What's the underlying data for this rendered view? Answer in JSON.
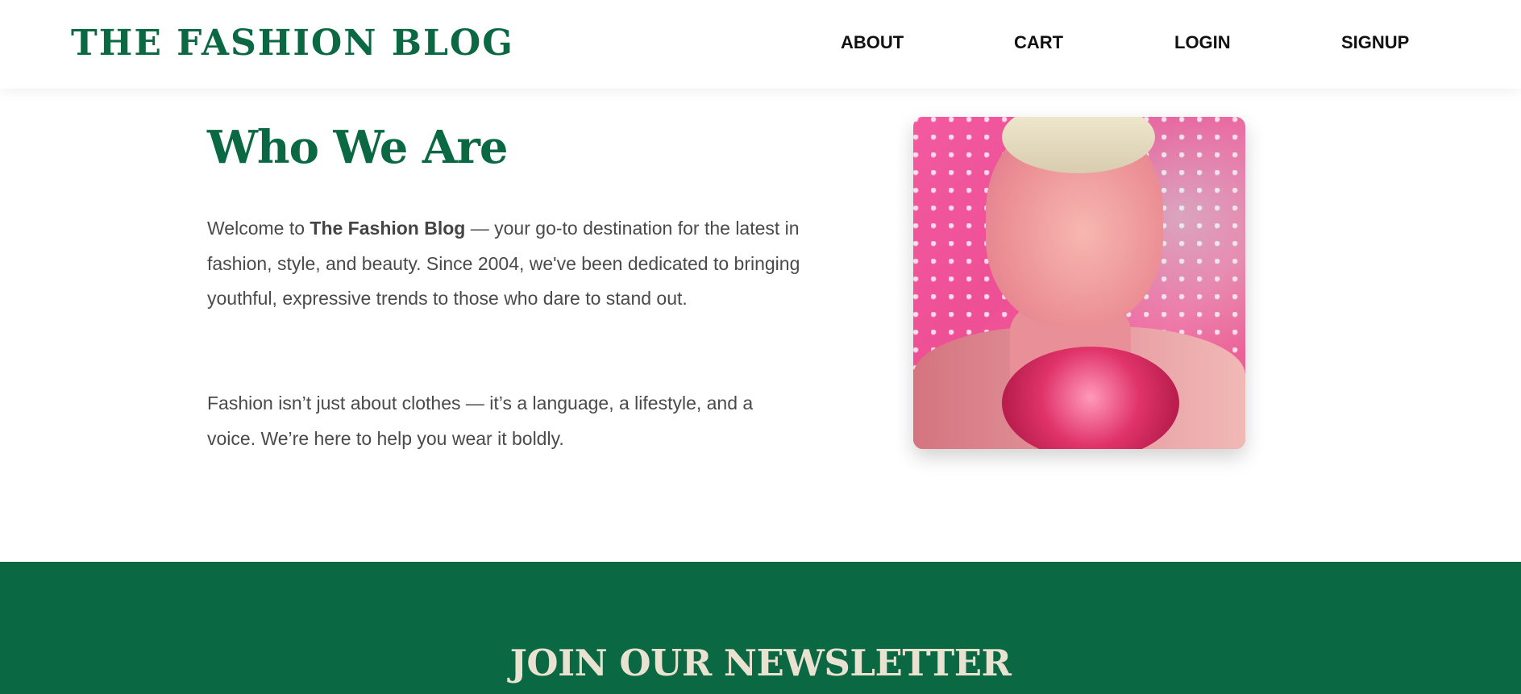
{
  "header": {
    "brand": "THE FASHION BLOG",
    "nav": {
      "about": "ABOUT",
      "cart": "CART",
      "login": "LOGIN",
      "signup": "SIGNUP"
    }
  },
  "about": {
    "heading": "Who We Are",
    "para1_prefix": "Welcome to ",
    "para1_bold": "The Fashion Blog",
    "para1_suffix": " — your go-to destination for the latest in fashion, style, and beauty. Since 2004, we've been dedicated to bringing youthful, expressive trends to those who dare to stand out.",
    "para2": "Fashion isn’t just about clothes — it’s a language, a lifestyle, and a voice. We’re here to help you wear it boldly."
  },
  "newsletter": {
    "title": "JOIN OUR NEWSLETTER"
  },
  "colors": {
    "brand_green": "#0a6843",
    "newsletter_text": "#e9e2d0",
    "body_text": "#4a4a4a"
  }
}
